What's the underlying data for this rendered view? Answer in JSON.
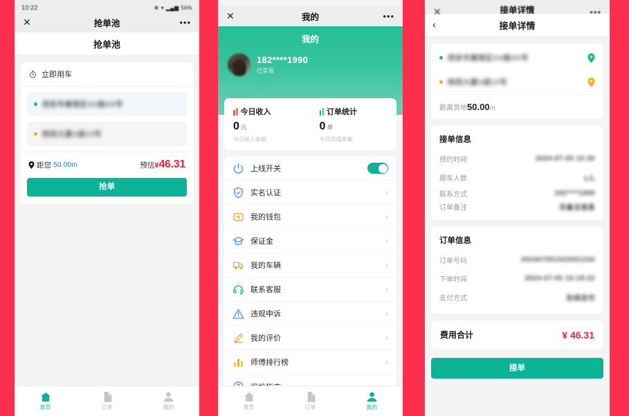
{
  "statusbar": {
    "time": "10:22",
    "battery": "56%",
    "signal": "all"
  },
  "phone1": {
    "nav": {
      "close": "✕",
      "title": "抢单池",
      "more": "•••"
    },
    "page_title": "抢单池",
    "card": {
      "type_label": "立即用车",
      "clock_icon": "clock-icon",
      "pickup_address": "西安市雁塔区XX路XX号",
      "dropoff_address": "陕西大厦A座12号",
      "distance_label": "距您",
      "distance_value": "50.00m",
      "estimate_label": "预估",
      "currency": "¥",
      "estimate_amount": "46.31",
      "grab_button": "抢单"
    },
    "tabs": [
      {
        "label": "首页",
        "icon": "home-icon",
        "active": true
      },
      {
        "label": "订单",
        "icon": "order-icon",
        "active": false
      },
      {
        "label": "我的",
        "icon": "person-icon",
        "active": false
      }
    ]
  },
  "phone2": {
    "nav": {
      "close": "✕",
      "title": "我的",
      "more": "•••"
    },
    "hero_title": "我的",
    "user": {
      "phone": "182****1990",
      "status": "已实名",
      "avatar": "avatar"
    },
    "stats": [
      {
        "title": "今日收入",
        "value": "0",
        "unit": "元",
        "sub": "今日收入金额",
        "bars": "red"
      },
      {
        "title": "订单统计",
        "value": "0",
        "unit": "单",
        "sub": "今日完成单量",
        "bars": "green"
      }
    ],
    "menu": [
      {
        "label": "上线开关",
        "icon": "power-icon",
        "control": "switch",
        "switch_on": true
      },
      {
        "label": "实名认证",
        "icon": "shield-check-icon",
        "control": "chevron"
      },
      {
        "label": "我的钱包",
        "icon": "wallet-icon",
        "control": "chevron"
      },
      {
        "label": "保证金",
        "icon": "graduation-cap-icon",
        "control": "chevron"
      },
      {
        "label": "我的车辆",
        "icon": "truck-icon",
        "control": "chevron"
      },
      {
        "label": "联系客服",
        "icon": "headset-icon",
        "control": "chevron"
      },
      {
        "label": "违规申诉",
        "icon": "warning-icon",
        "control": "chevron"
      },
      {
        "label": "我的评价",
        "icon": "pencil-icon",
        "control": "chevron"
      },
      {
        "label": "师傅排行榜",
        "icon": "bar-chart-icon",
        "control": "chevron"
      },
      {
        "label": "司机指南",
        "icon": "question-circle-icon",
        "control": "chevron"
      }
    ],
    "tabs": [
      {
        "label": "首页",
        "icon": "home-icon",
        "active": false
      },
      {
        "label": "订单",
        "icon": "order-icon",
        "active": false
      },
      {
        "label": "我的",
        "icon": "person-icon",
        "active": true
      }
    ]
  },
  "phone3": {
    "nav": {
      "close": "✕",
      "title": "接单详情",
      "more": "•••"
    },
    "page_title": "接单详情",
    "back_icon": "chevron-left-icon",
    "addresses": {
      "pickup": "西安市雁塔区XX路XX号",
      "dropoff": "陕西大厦A座12号",
      "distance_label": "距离货地",
      "distance_value": "50.00",
      "distance_unit": "m"
    },
    "accept_info": {
      "title": "接单信息",
      "rows": [
        {
          "key": "预约时间",
          "value": "2024-07-05 10:30"
        },
        {
          "key": "跟车人数",
          "value": "1人"
        },
        {
          "key": "联系方式",
          "value": "182****1990"
        },
        {
          "key": "订单备注",
          "value": "无备注信息"
        }
      ]
    },
    "order_info": {
      "title": "订单信息",
      "rows": [
        {
          "key": "订单号码",
          "value": "202407051022001234"
        },
        {
          "key": "下单时间",
          "value": "2024-07-05 10:18:22"
        },
        {
          "key": "支付方式",
          "value": "在线支付"
        }
      ]
    },
    "total": {
      "label": "费用合计",
      "currency": "¥",
      "amount": "46.31"
    },
    "accept_button": "接单"
  },
  "colors": {
    "background_red": "#FB2E4E",
    "brand_green": "#0CB396",
    "hero_green_top": "#24BE93",
    "hero_green_bottom": "#6DD0B4",
    "price_red": "#F3203C",
    "link_blue": "#1C7FD6",
    "muted_gray": "#9B9B9B"
  }
}
